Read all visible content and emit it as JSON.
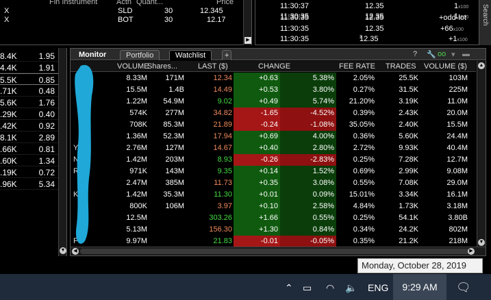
{
  "orders": {
    "headers": [
      "Fin Instrument",
      "Actn",
      "Quant...",
      "Price"
    ],
    "rows": [
      {
        "x": "X",
        "action": "SLD",
        "quantity": "30",
        "price": "12.345"
      },
      {
        "x": "X",
        "action": "BOT",
        "quantity": "30",
        "price": "12.17"
      }
    ]
  },
  "time_sales": {
    "rows": [
      {
        "time": "11:30:37",
        "price": "12.35",
        "size": "1",
        "mult": "x100"
      },
      {
        "time": "11:30:35",
        "price": "12.35",
        "size": "1",
        "mult": "x100"
      },
      {
        "time": "11:30:35",
        "price": "12.35",
        "size": "+odd-lot",
        "mult": ""
      },
      {
        "time": "11:30:35",
        "price": "12.35",
        "size": "+66",
        "mult": "x100"
      },
      {
        "time": "11:30:35",
        "price": "12.35",
        "price_sup": "3",
        "size": "+1",
        "mult": "x100"
      }
    ],
    "search_label": "Search"
  },
  "left_prices": {
    "rows": [
      {
        "a": "8.4K",
        "b": "1.95"
      },
      {
        "a": "4.4K",
        "b": "1.91"
      },
      {
        "a": "5.5K",
        "b": "0.85"
      },
      {
        "a": ".71K",
        "b": "0.48"
      },
      {
        "a": "5.6K",
        "b": "1.76"
      },
      {
        "a": ".29K",
        "b": "0.40"
      },
      {
        "a": ".42K",
        "b": "0.92"
      },
      {
        "a": "8.1K",
        "b": "2.89"
      },
      {
        "a": ".66K",
        "b": "0.81"
      },
      {
        "a": ".60K",
        "b": "1.34"
      },
      {
        "a": ".19K",
        "b": "0.72"
      },
      {
        "a": ".96K",
        "b": "5.34"
      }
    ]
  },
  "monitor": {
    "tabs": [
      "Monitor",
      "Portfolio",
      "Watchlist",
      "+"
    ],
    "tool_help": "?",
    "columns": [
      "VOLUME",
      "Shares...",
      "LAST ($)",
      "CHANGE",
      "FEE RATE",
      "TRADES",
      "VOLUME ($)"
    ],
    "rows": [
      {
        "sym": "",
        "vol": "8.33M",
        "shares": "171M",
        "last": "12.34",
        "last_color": "#f08a5d",
        "chg": "+0.63",
        "pct": "5.38%",
        "neg": false,
        "fee": "2.05%",
        "trades": "25.5K",
        "volusd": "103M"
      },
      {
        "sym": "",
        "vol": "15.5M",
        "shares": "1.4B",
        "last": "14.49",
        "last_color": "#f08a5d",
        "chg": "+0.53",
        "pct": "3.80%",
        "neg": false,
        "fee": "0.27%",
        "trades": "31.5K",
        "volusd": "225M"
      },
      {
        "sym": "",
        "vol": "1.22M",
        "shares": "54.9M",
        "last": "9.02",
        "last_color": "#44dd44",
        "chg": "+0.49",
        "pct": "5.74%",
        "neg": false,
        "fee": "21.20%",
        "trades": "3.19K",
        "volusd": "11.0M"
      },
      {
        "sym": "",
        "vol": "574K",
        "shares": "277M",
        "last": "34.82",
        "last_color": "#f08a5d",
        "chg": "-1.65",
        "pct": "-4.52%",
        "neg": true,
        "fee": "0.39%",
        "trades": "2.43K",
        "volusd": "20.0M"
      },
      {
        "sym": "",
        "vol": "708K",
        "shares": "85.3M",
        "last": "21.89",
        "last_color": "#f08a5d",
        "chg": "-0.24",
        "pct": "-1.08%",
        "neg": true,
        "fee": "35.05%",
        "trades": "2.40K",
        "volusd": "15.5M"
      },
      {
        "sym": "",
        "vol": "1.36M",
        "shares": "52.3M",
        "last": "17.94",
        "last_color": "#f08a5d",
        "chg": "+0.69",
        "pct": "4.00%",
        "neg": false,
        "fee": "0.36%",
        "trades": "5.60K",
        "volusd": "24.4M"
      },
      {
        "sym": "Y",
        "vol": "2.76M",
        "shares": "127M",
        "last": "14.67",
        "last_color": "#f08a5d",
        "chg": "+0.40",
        "pct": "2.80%",
        "neg": false,
        "fee": "2.72%",
        "trades": "9.93K",
        "volusd": "40.4M"
      },
      {
        "sym": "N",
        "vol": "1.42M",
        "shares": "203M",
        "last": "8.93",
        "last_color": "#44dd44",
        "chg": "-0.26",
        "pct": "-2.83%",
        "neg": true,
        "fee": "0.25%",
        "trades": "7.28K",
        "volusd": "12.7M"
      },
      {
        "sym": "R",
        "vol": "971K",
        "shares": "143M",
        "last": "9.35",
        "last_color": "#44dd44",
        "chg": "+0.14",
        "pct": "1.52%",
        "neg": false,
        "fee": "0.69%",
        "trades": "2.99K",
        "volusd": "9.08M"
      },
      {
        "sym": "",
        "vol": "2.47M",
        "shares": "385M",
        "last": "11.73",
        "last_color": "#f08a5d",
        "chg": "+0.35",
        "pct": "3.08%",
        "neg": false,
        "fee": "0.55%",
        "trades": "7.08K",
        "volusd": "29.0M"
      },
      {
        "sym": "K",
        "vol": "1.42M",
        "shares": "35.3M",
        "last": "11.30",
        "last_color": "#44dd44",
        "chg": "+0.01",
        "pct": "0.09%",
        "neg": false,
        "fee": "15.01%",
        "trades": "3.34K",
        "volusd": "16.1M"
      },
      {
        "sym": "",
        "vol": "800K",
        "shares": "106M",
        "last": "3.97",
        "last_color": "#f08a5d",
        "chg": "+0.10",
        "pct": "2.58%",
        "neg": false,
        "fee": "4.84%",
        "trades": "1.73K",
        "volusd": "3.18M"
      },
      {
        "sym": "",
        "vol": "12.5M",
        "shares": "",
        "last": "303.26",
        "last_color": "#44dd44",
        "chg": "+1.66",
        "pct": "0.55%",
        "neg": false,
        "fee": "0.25%",
        "trades": "54.1K",
        "volusd": "3.80B"
      },
      {
        "sym": "",
        "vol": "5.13M",
        "shares": "",
        "last": "156.30",
        "last_color": "#f08a5d",
        "chg": "+1.30",
        "pct": "0.84%",
        "neg": false,
        "fee": "0.34%",
        "trades": "24.2K",
        "volusd": "802M"
      },
      {
        "sym": "P",
        "vol": "9.97M",
        "shares": "",
        "last": "21.83",
        "last_color": "#44dd44",
        "chg": "-0.01",
        "pct": "-0.05%",
        "neg": true,
        "fee": "0.35%",
        "trades": "21.2K",
        "volusd": "218M"
      }
    ]
  },
  "taskbar": {
    "date_tooltip": "Monday, October 28, 2019",
    "language": "ENG",
    "time": "9:29 AM",
    "icons": [
      "chevron-up-icon",
      "power-icon",
      "wifi-icon",
      "volume-icon",
      "notification-icon"
    ]
  }
}
